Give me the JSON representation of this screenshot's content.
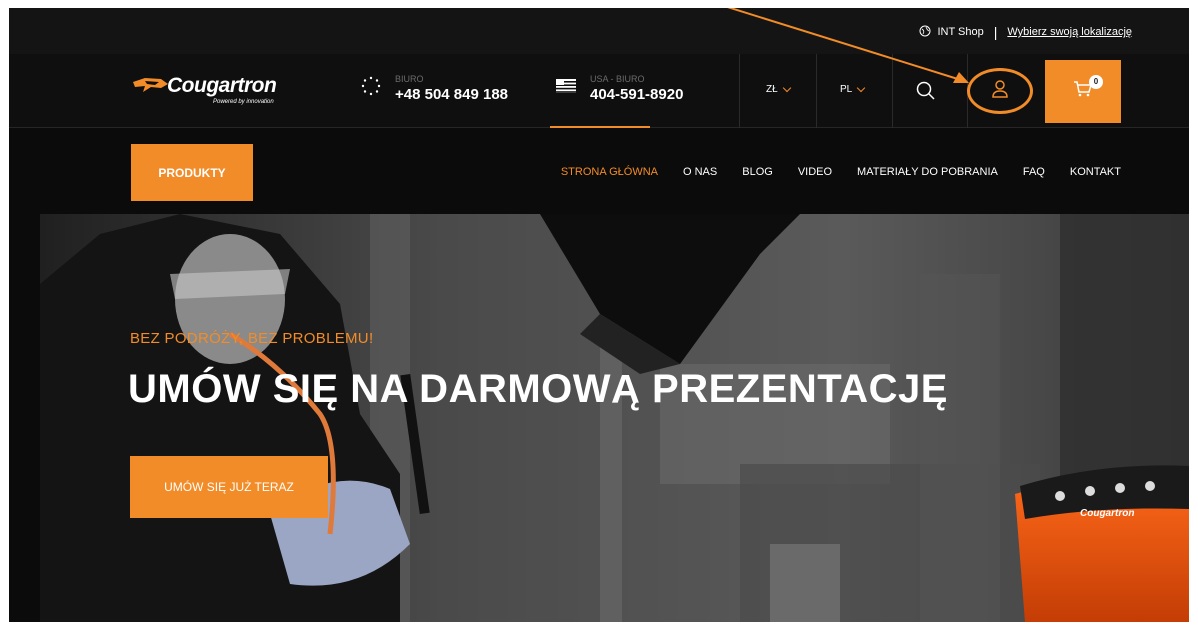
{
  "topbar": {
    "shop_label": "INT Shop",
    "separator": "|",
    "location_link": "Wybierz swoją lokalizację"
  },
  "header": {
    "logo_name": "Cougartron",
    "logo_tagline": "Powered by innovation",
    "phone_eu": {
      "label": "BIURO",
      "number": "+48 504 849 188"
    },
    "phone_us": {
      "label": "USA - BIURO",
      "number": "404-591-8920"
    },
    "currency": "ZŁ",
    "language": "PL",
    "cart_count": "0"
  },
  "nav": {
    "products_button": "PRODUKTY",
    "items": [
      {
        "label": "STRONA GŁÓWNA",
        "active": true
      },
      {
        "label": "O NAS"
      },
      {
        "label": "BLOG"
      },
      {
        "label": "VIDEO"
      },
      {
        "label": "MATERIAŁY DO POBRANIA"
      },
      {
        "label": "FAQ"
      },
      {
        "label": "KONTAKT"
      }
    ]
  },
  "hero": {
    "kicker": "BEZ PODRÓŻY, BEZ PROBLEMU!",
    "title": "UMÓW SIĘ NA DARMOWĄ PREZENTACJĘ",
    "cta": "UMÓW SIĘ JUŻ TERAZ",
    "machine_brand": "Cougartron"
  },
  "icons": {
    "globe": "globe-icon",
    "dots": "dots-icon",
    "flag": "us-flag-icon",
    "search": "search-icon",
    "account": "user-icon",
    "cart": "cart-icon"
  },
  "colors": {
    "accent": "#f28c28",
    "background": "#0b0b0b",
    "annotation": "#f28c28"
  }
}
